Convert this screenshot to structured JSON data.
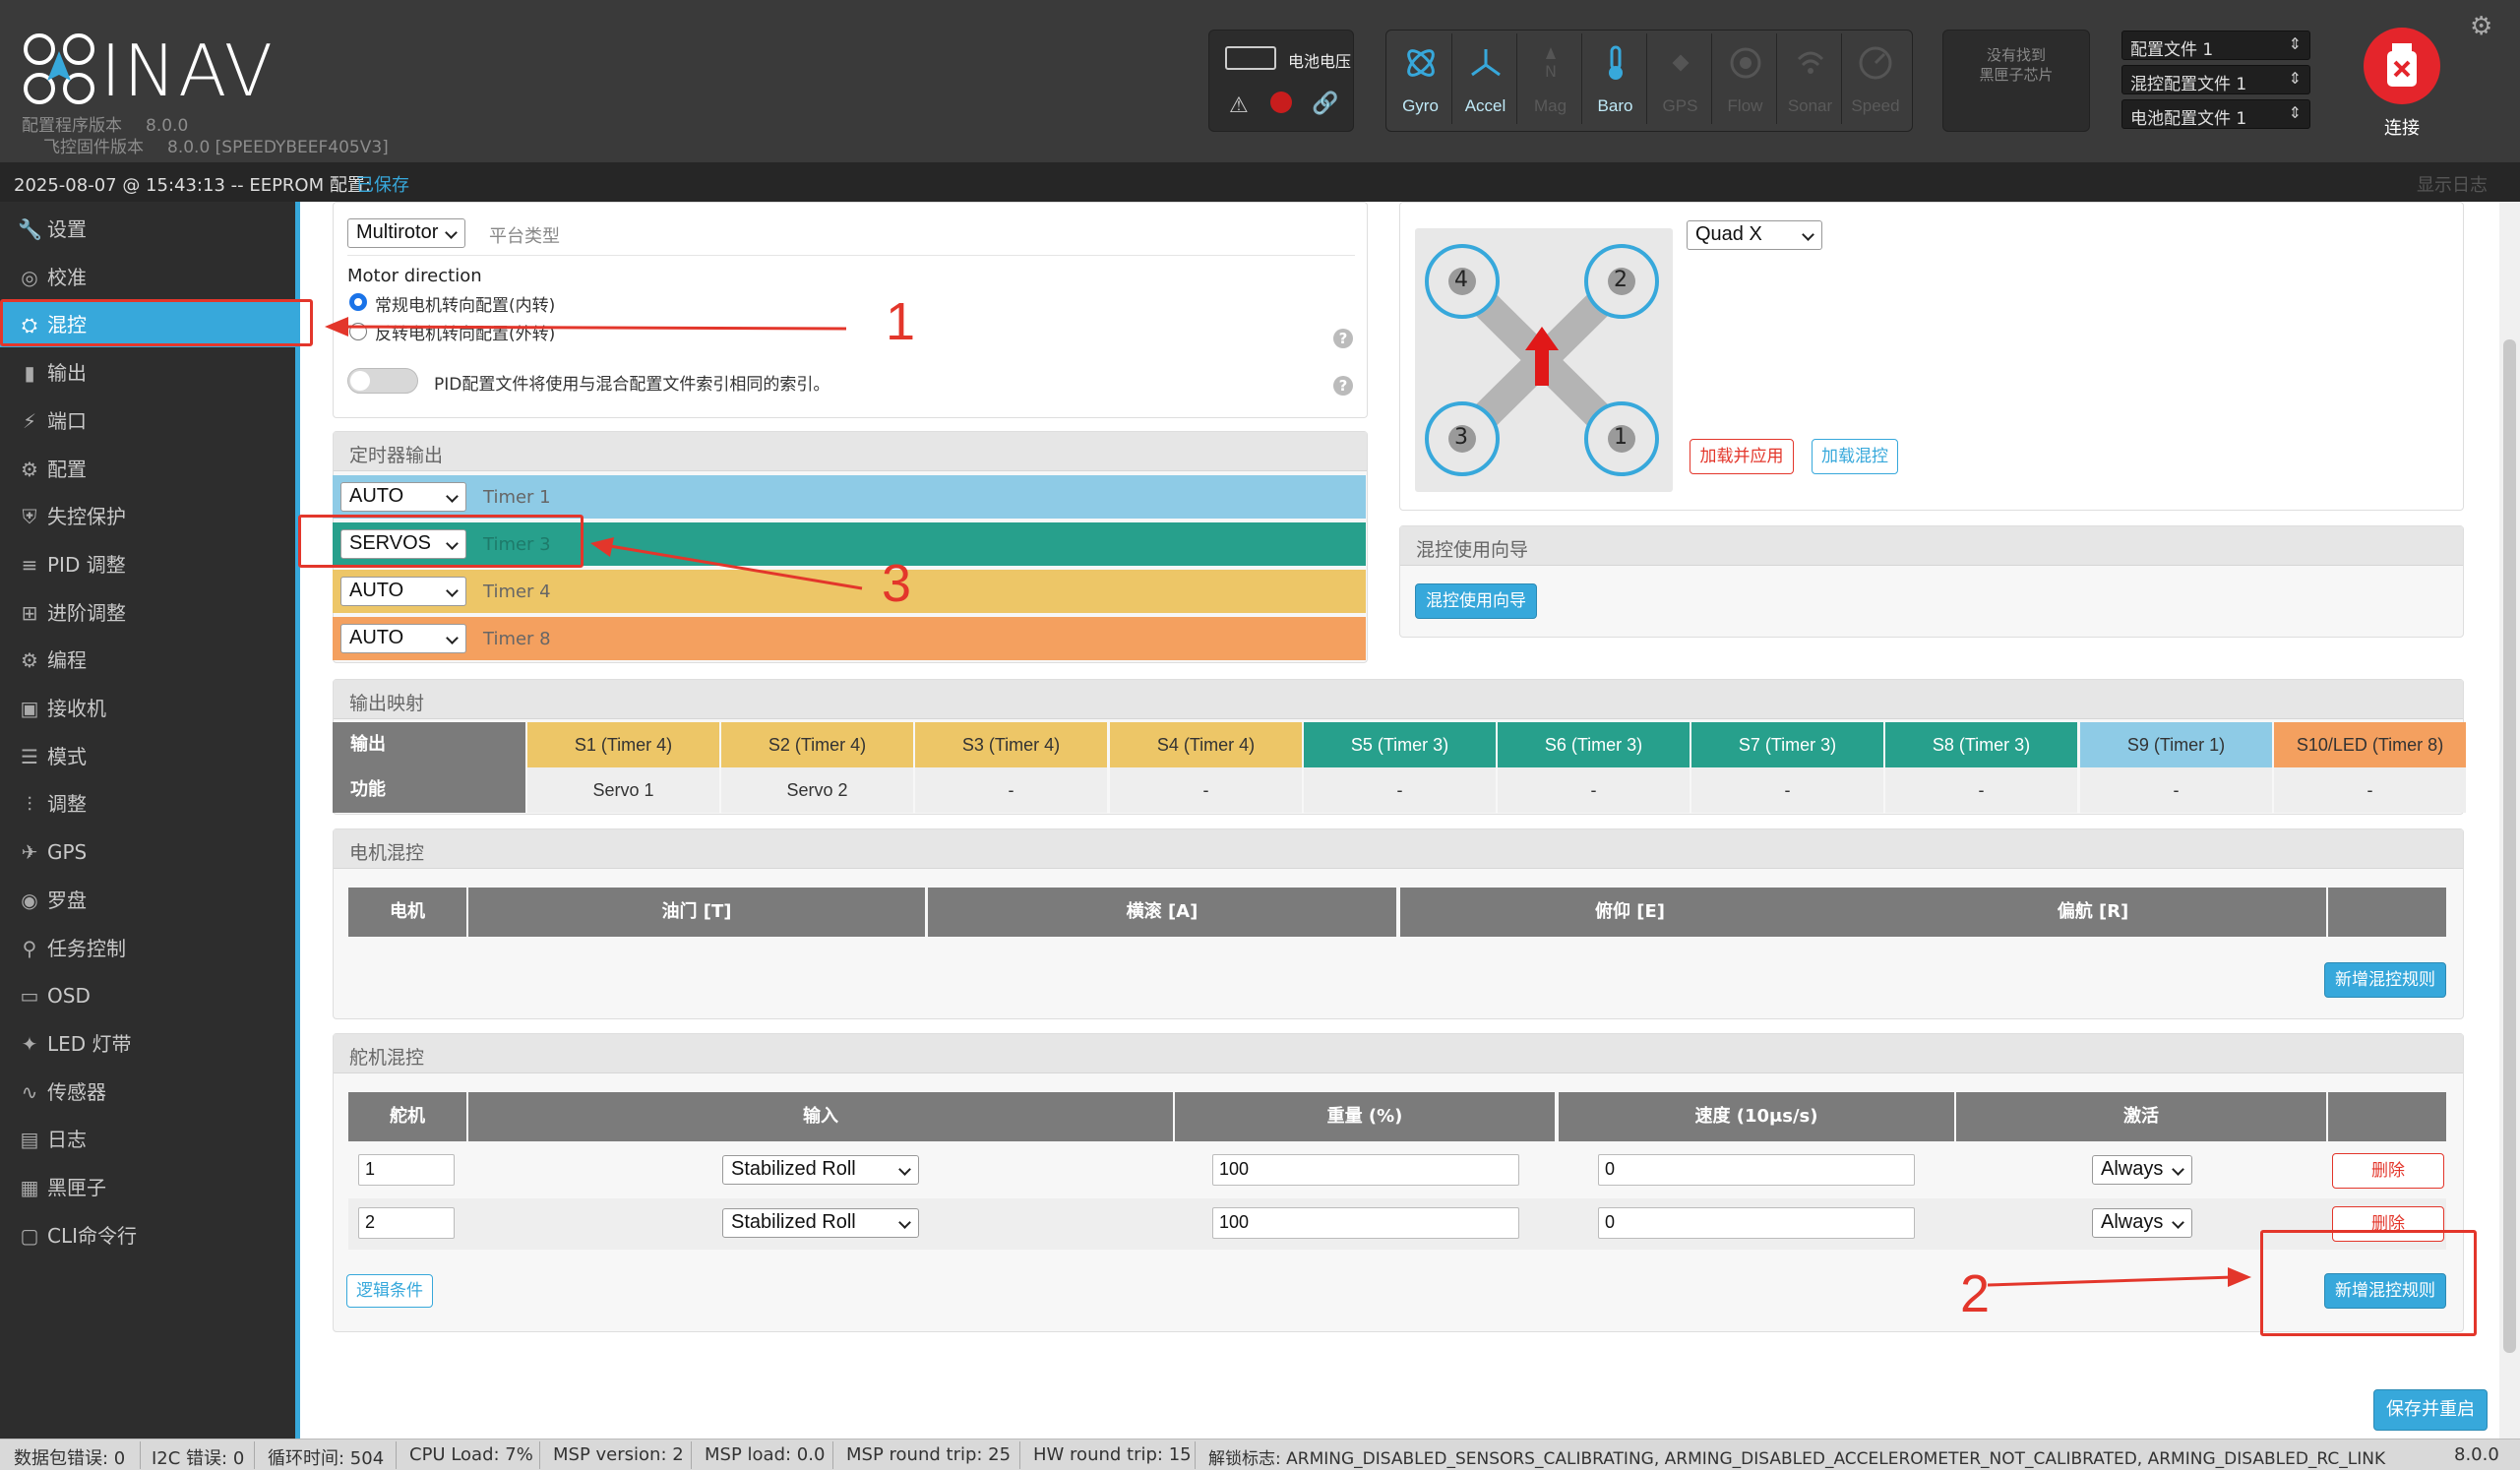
{
  "header": {
    "logo_text": "INAV",
    "configurator_label": "配置程序版本",
    "configurator_version": "8.0.0",
    "firmware_label": "飞控固件版本",
    "firmware_version": "8.0.0 [SPEEDYBEEF405V3]",
    "battery_label": "电池电压",
    "sensors": [
      {
        "name": "Gyro",
        "state": "on"
      },
      {
        "name": "Accel",
        "state": "on"
      },
      {
        "name": "Mag",
        "state": "off"
      },
      {
        "name": "Baro",
        "state": "on"
      },
      {
        "name": "GPS",
        "state": "off"
      },
      {
        "name": "Flow",
        "state": "off"
      },
      {
        "name": "Sonar",
        "state": "off"
      },
      {
        "name": "Speed",
        "state": "off"
      }
    ],
    "blackbox_line1": "没有找到",
    "blackbox_line2": "黑匣子芯片",
    "profile_select": "配置文件 1",
    "mixer_profile_select": "混控配置文件 1",
    "battery_profile_select": "电池配置文件 1",
    "connect_label": "连接"
  },
  "statusbar": {
    "datetime": "2025-08-07 @ 15:43:13 -- EEPROM 配置:",
    "eeprom_state": "已保存",
    "show_log": "显示日志"
  },
  "sidebar": {
    "items": [
      {
        "label": "设置",
        "icon": "wrench-icon"
      },
      {
        "label": "校准",
        "icon": "calibrate-icon"
      },
      {
        "label": "混控",
        "icon": "mixer-icon"
      },
      {
        "label": "输出",
        "icon": "output-icon"
      },
      {
        "label": "端口",
        "icon": "ports-icon"
      },
      {
        "label": "配置",
        "icon": "gear-icon"
      },
      {
        "label": "失控保护",
        "icon": "failsafe-icon"
      },
      {
        "label": "PID 调整",
        "icon": "pid-icon"
      },
      {
        "label": "进阶调整",
        "icon": "advanced-tuning-icon"
      },
      {
        "label": "编程",
        "icon": "programming-icon"
      },
      {
        "label": "接收机",
        "icon": "receiver-icon"
      },
      {
        "label": "模式",
        "icon": "modes-icon"
      },
      {
        "label": "调整",
        "icon": "adjustments-icon"
      },
      {
        "label": "GPS",
        "icon": "gps-icon"
      },
      {
        "label": "罗盘",
        "icon": "compass-icon"
      },
      {
        "label": "任务控制",
        "icon": "mission-icon"
      },
      {
        "label": "OSD",
        "icon": "osd-icon"
      },
      {
        "label": "LED 灯带",
        "icon": "led-icon"
      },
      {
        "label": "传感器",
        "icon": "sensors-icon"
      },
      {
        "label": "日志",
        "icon": "logging-icon"
      },
      {
        "label": "黑匣子",
        "icon": "blackbox-icon"
      },
      {
        "label": "CLI命令行",
        "icon": "cli-icon"
      }
    ]
  },
  "platform": {
    "type_value": "Multirotor",
    "type_label": "平台类型",
    "motor_direction_title": "Motor direction",
    "motor_dir_normal": "常规电机转向配置(内转)",
    "motor_dir_reversed": "反转电机转向配置(外转)",
    "pid_toggle_label": "PID配置文件将使用与混合配置文件索引相同的索引。"
  },
  "timers": {
    "title": "定时器输出",
    "rows": [
      {
        "mode": "AUTO",
        "label": "Timer 1",
        "color": "#8ecbe6"
      },
      {
        "mode": "SERVOS",
        "label": "Timer 3",
        "color": "#27a08c"
      },
      {
        "mode": "AUTO",
        "label": "Timer 4",
        "color": "#edc667"
      },
      {
        "mode": "AUTO",
        "label": "Timer 8",
        "color": "#f4a05f"
      }
    ]
  },
  "model": {
    "preset": "Quad X",
    "load_apply": "加载并应用",
    "load_mixer": "加载混控",
    "motors": [
      "4",
      "2",
      "3",
      "1"
    ]
  },
  "wizard": {
    "title": "混控使用向导",
    "button": "混控使用向导"
  },
  "output_mapping": {
    "title": "输出映射",
    "row1_label": "输出",
    "row2_label": "功能",
    "outputs": [
      {
        "name": "S1 (Timer 4)",
        "func": "Servo 1",
        "color": "#edc667"
      },
      {
        "name": "S2 (Timer 4)",
        "func": "Servo 2",
        "color": "#edc667"
      },
      {
        "name": "S3 (Timer 4)",
        "func": "-",
        "color": "#edc667"
      },
      {
        "name": "S4 (Timer 4)",
        "func": "-",
        "color": "#edc667"
      },
      {
        "name": "S5 (Timer 3)",
        "func": "-",
        "color": "#27a08c"
      },
      {
        "name": "S6 (Timer 3)",
        "func": "-",
        "color": "#27a08c"
      },
      {
        "name": "S7 (Timer 3)",
        "func": "-",
        "color": "#27a08c"
      },
      {
        "name": "S8 (Timer 3)",
        "func": "-",
        "color": "#27a08c"
      },
      {
        "name": "S9 (Timer 1)",
        "func": "-",
        "color": "#8ecbe6"
      },
      {
        "name": "S10/LED (Timer 8)",
        "func": "-",
        "color": "#f4a05f"
      }
    ]
  },
  "motor_mix": {
    "title": "电机混控",
    "headers": [
      "电机",
      "油门 [T]",
      "横滚 [A]",
      "俯仰 [E]",
      "偏航 [R]",
      ""
    ],
    "add_button": "新增混控规则"
  },
  "servo_mix": {
    "title": "舵机混控",
    "headers": [
      "舵机",
      "输入",
      "重量 (%)",
      "速度 (10μs/s)",
      "激活",
      ""
    ],
    "rows": [
      {
        "servo": "1",
        "input": "Stabilized Roll",
        "weight": "100",
        "speed": "0",
        "activate": "Always",
        "delete": "删除"
      },
      {
        "servo": "2",
        "input": "Stabilized Roll",
        "weight": "100",
        "speed": "0",
        "activate": "Always",
        "delete": "删除"
      }
    ],
    "logic_button": "逻辑条件",
    "add_button": "新增混控规则"
  },
  "save_button": "保存并重启",
  "annotations": {
    "one": "1",
    "two": "2",
    "three": "3"
  },
  "bottom": {
    "packet_error": "数据包错误: 0",
    "i2c_error": "I2C 错误: 0",
    "cycle_time": "循环时间: 504",
    "cpu_load": "CPU Load: 7%",
    "msp_version": "MSP version: 2",
    "msp_load": "MSP load: 0.0",
    "msp_round_trip": "MSP round trip: 25",
    "hw_round_trip": "HW round trip: 15",
    "arming_flags": "解锁标志: ARMING_DISABLED_SENSORS_CALIBRATING, ARMING_DISABLED_ACCELEROMETER_NOT_CALIBRATED, ARMING_DISABLED_RC_LINK",
    "version": "8.0.0"
  },
  "colors": {
    "accent": "#37a8db",
    "annotation": "#e3362b"
  }
}
